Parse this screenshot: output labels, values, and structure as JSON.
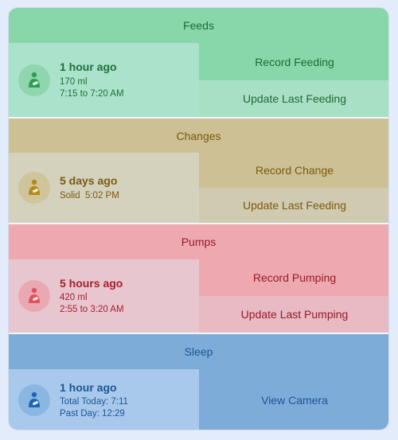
{
  "colors": {
    "feeds_accent": "#2e9e4f",
    "changes_accent": "#b38a1d",
    "pumps_accent": "#e0535e",
    "sleep_accent": "#1f67b3"
  },
  "feeds": {
    "header": "Feeds",
    "icon": "baby-bottle-icon",
    "title": "1 hour ago",
    "line1": "170 ml",
    "line2": "7:15 to 7:20 AM",
    "button_primary": "Record Feeding",
    "button_secondary": "Update Last Feeding"
  },
  "changes": {
    "header": "Changes",
    "icon": "diaper-icon",
    "title": "5 days ago",
    "line1": "Solid  5:02 PM",
    "button_primary": "Record Change",
    "button_secondary": "Update Last Feeding"
  },
  "pumps": {
    "header": "Pumps",
    "icon": "breast-pump-icon",
    "title": "5 hours ago",
    "line1": "420 ml",
    "line2": "2:55 to 3:20 AM",
    "button_primary": "Record Pumping",
    "button_secondary": "Update Last Pumping"
  },
  "sleep": {
    "header": "Sleep",
    "icon": "sleep-icon",
    "title": "1 hour ago",
    "line1": "Total Today: 7:11",
    "line2": "Past Day: 12:29",
    "button_primary": "View Camera"
  }
}
